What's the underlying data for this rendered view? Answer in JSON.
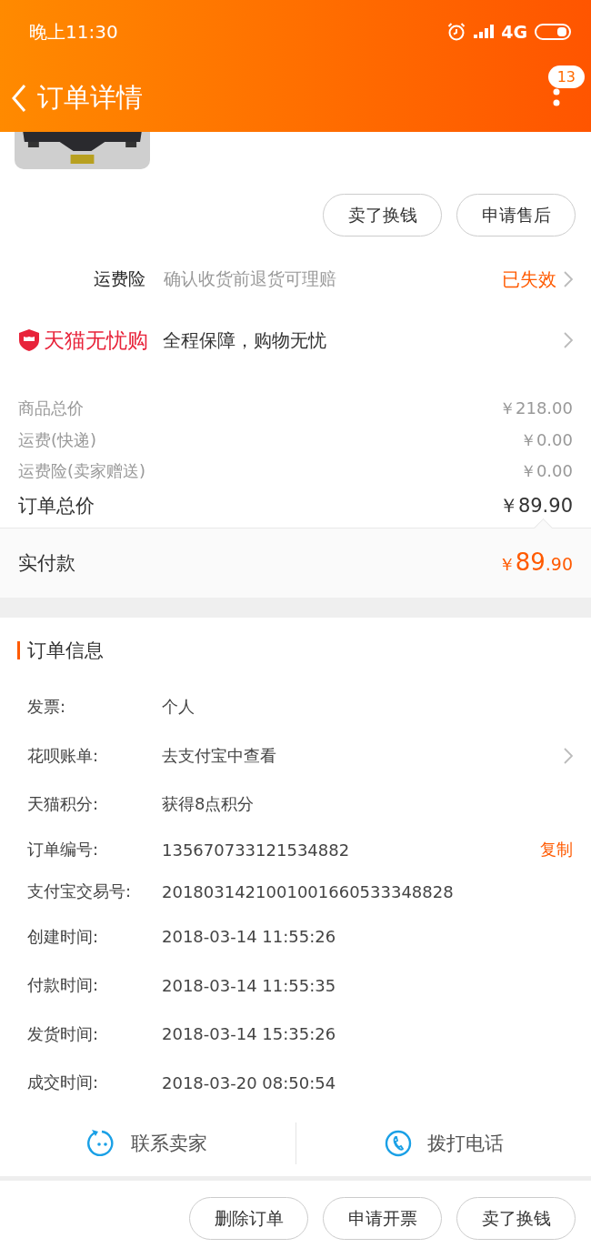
{
  "status_bar": {
    "time": "晚上11:30",
    "network": "4G"
  },
  "nav": {
    "title": "订单详情",
    "badge": "13"
  },
  "product": {
    "kind": "picture"
  },
  "item_actions": [
    "卖了换钱",
    "申请售后"
  ],
  "shipping_insurance": {
    "label": "运费险",
    "description": "确认收货前退货可理赔",
    "status": "已失效"
  },
  "guarantee": {
    "brand": "天猫无忧购",
    "slogan": "全程保障，购物无忧"
  },
  "price_rows": [
    {
      "label": "商品总价",
      "value": "￥218.00",
      "kind": "minor"
    },
    {
      "label": "运费(快递)",
      "value": "￥0.00",
      "kind": "minor"
    },
    {
      "label": "运费险(卖家赠送)",
      "value": "￥0.00",
      "kind": "minor"
    },
    {
      "label": "订单总价",
      "value": "￥89.90",
      "kind": "total"
    }
  ],
  "paid": {
    "label": "实付款",
    "currency": "￥",
    "integer": "89",
    "decimal": ".90"
  },
  "order_info": {
    "title": "订单信息",
    "rows": [
      {
        "label": "发票:",
        "value": "个人",
        "kind": "plain"
      },
      {
        "label": "花呗账单:",
        "value": "去支付宝中查看",
        "kind": "link"
      },
      {
        "label": "天猫积分:",
        "value": "获得8点积分",
        "kind": "plain"
      },
      {
        "label": "订单编号:",
        "value": "135670733121534882",
        "kind": "copy",
        "action_text": "复制"
      },
      {
        "label": "支付宝交易号:",
        "value": "2018031421001001660533348828",
        "kind": "plain"
      },
      {
        "label": "创建时间:",
        "value": "2018-03-14 11:55:26",
        "kind": "plain"
      },
      {
        "label": "付款时间:",
        "value": "2018-03-14 11:55:35",
        "kind": "plain"
      },
      {
        "label": "发货时间:",
        "value": "2018-03-14 15:35:26",
        "kind": "plain"
      },
      {
        "label": "成交时间:",
        "value": "2018-03-20 08:50:54",
        "kind": "plain"
      }
    ]
  },
  "contact": [
    {
      "label": "联系卖家",
      "kind": "chat"
    },
    {
      "label": "拨打电话",
      "kind": "phone"
    }
  ],
  "bottom_actions": [
    "删除订单",
    "申请开票",
    "卖了换钱"
  ]
}
